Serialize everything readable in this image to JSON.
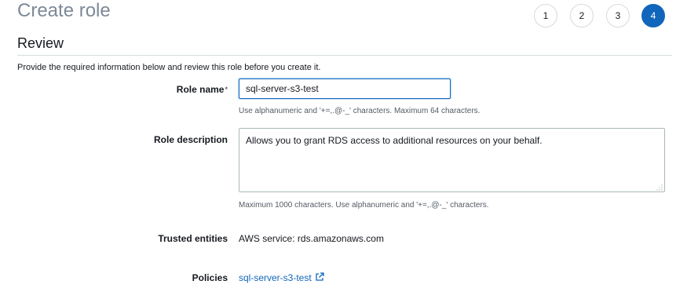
{
  "header": {
    "title": "Create role"
  },
  "steps": [
    "1",
    "2",
    "3",
    "4"
  ],
  "active_step": "4",
  "review": {
    "section_title": "Review",
    "intro": "Provide the required information below and review this role before you create it."
  },
  "form": {
    "role_name": {
      "label": "Role name",
      "required_mark": "*",
      "value": "sql-server-s3-test",
      "hint": "Use alphanumeric and '+=,.@-_' characters. Maximum 64 characters."
    },
    "role_description": {
      "label": "Role description",
      "value": "Allows you to grant RDS access to additional resources on your behalf.",
      "hint": "Maximum 1000 characters. Use alphanumeric and '+=,.@-_' characters."
    },
    "trusted_entities": {
      "label": "Trusted entities",
      "value": "AWS service: rds.amazonaws.com"
    },
    "policies": {
      "label": "Policies",
      "link_text": "sql-server-s3-test",
      "icon": "external-link-icon"
    }
  },
  "colors": {
    "accent": "#1166bb",
    "title_gray": "#7d8998",
    "border": "#aab7b8"
  }
}
